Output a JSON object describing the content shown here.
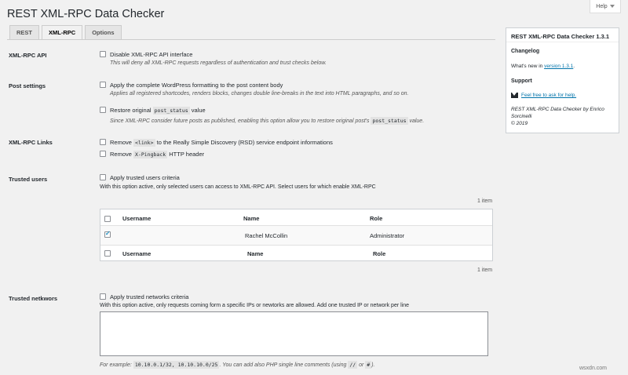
{
  "page": {
    "title": "REST XML-RPC Data Checker",
    "help_label": "Help"
  },
  "tabs": [
    {
      "label": "REST",
      "active": false
    },
    {
      "label": "XML-RPC",
      "active": true
    },
    {
      "label": "Options",
      "active": false
    }
  ],
  "sections": {
    "xmlrpc_api": {
      "label": "XML-RPC API",
      "option": "Disable XML-RPC API interface",
      "desc": "This will deny all XML-RPC requests regardless of authentication and trust checks below."
    },
    "post_settings": {
      "label": "Post settings",
      "option1": "Apply the complete WordPress formatting to the post content body",
      "desc1": "Applies all registered shortcodes, renders blocks, changes double line-breaks in the text into HTML paragraphs, and so on.",
      "option2_pre": "Restore original",
      "option2_code": "post_status",
      "option2_post": "value",
      "desc2_pre": "Since XML-RPC consider future posts as published, enabling this option allow you to restore original post's",
      "desc2_code": "post_status",
      "desc2_post": "value."
    },
    "xmlrpc_links": {
      "label": "XML-RPC Links",
      "option1_pre": "Remove",
      "option1_code": "<link>",
      "option1_post": "to the Really Simple Discovery (RSD) service endpoint informations",
      "option2_pre": "Remove",
      "option2_code": "X-Pingback",
      "option2_post": "HTTP header"
    },
    "trusted_users": {
      "label": "Trusted users",
      "option": "Apply trusted users criteria",
      "desc": "With this option active, only selected users can access to XML-RPC API. Select users for which enable XML-RPC",
      "count_top": "1 item",
      "count_bottom": "1 item",
      "columns": [
        "Username",
        "Name",
        "Role"
      ],
      "rows": [
        {
          "checked": true,
          "username": "",
          "name": "Rachel McCollin",
          "role": "Administrator"
        }
      ]
    },
    "trusted_networks": {
      "label": "Trusted netkwors",
      "option": "Apply trusted networks criteria",
      "desc": "With this option active, only requests coming form a specific IPs or newtorks are allowed. Add one trusted IP or network per line",
      "textarea_value": "",
      "example_pre": "For example:",
      "example_code": "10.10.0.1/32, 10.10.10.0/25",
      "example_mid": ". You can add also PHP single line comments (using",
      "example_code2": "//",
      "example_or": "or",
      "example_code3": "#",
      "example_post": ")."
    }
  },
  "sidebar": {
    "title": "REST XML-RPC Data Checker 1.3.1",
    "changelog_heading": "Changelog",
    "whats_new_pre": "What's new in",
    "whats_new_link": "version 1.3.1",
    "whats_new_post": ".",
    "support_heading": "Support",
    "support_link": "Feel free to ask for help.",
    "credit_line1": "REST XML-RPC Data Checker by Enrico",
    "credit_line2": "Sorcinelli",
    "credit_line3": "© 2019",
    "icons": {
      "support": "mail-icon"
    }
  },
  "watermark": "wsxdn.com"
}
